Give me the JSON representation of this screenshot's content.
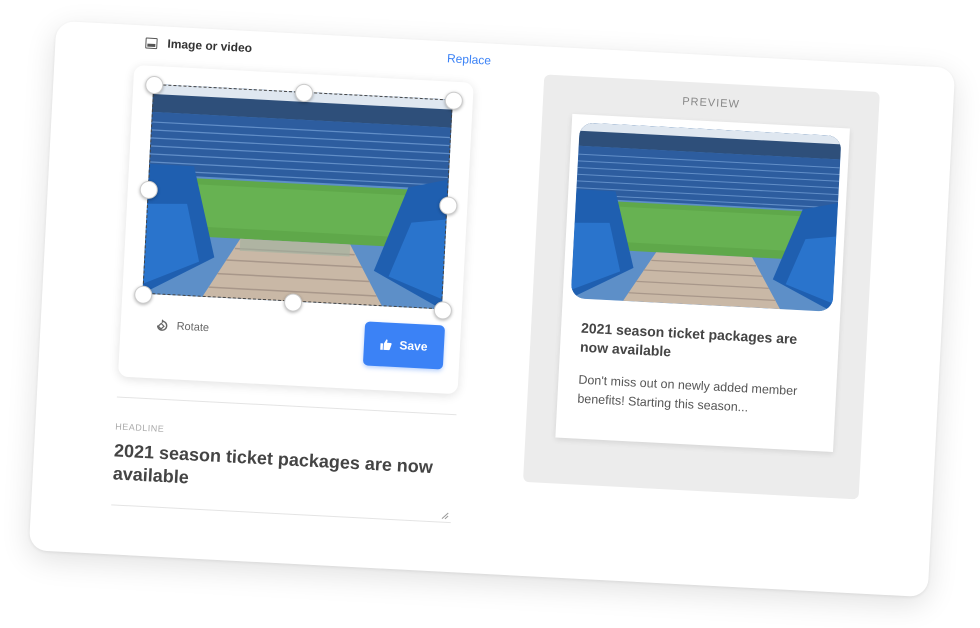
{
  "editor": {
    "media_label": "Image or video",
    "replace_label": "Replace",
    "rotate_label": "Rotate",
    "save_label": "Save",
    "headline_label": "HEADLINE",
    "headline_value": "2021 season ticket packages are now available"
  },
  "preview": {
    "label": "PREVIEW",
    "title": "2021 season ticket packages are now available",
    "body": "Don't miss out on newly added member benefits! Starting this season..."
  },
  "colors": {
    "accent": "#3b82f6",
    "preview_panel": "#ececec",
    "headline_text": "#444444"
  },
  "icons": {
    "media": "image-icon",
    "rotate": "rotate-icon",
    "save": "thumbs-up-icon"
  }
}
